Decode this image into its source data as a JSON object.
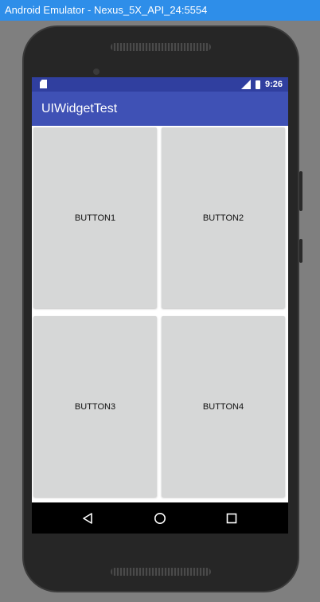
{
  "window": {
    "title": "Android Emulator - Nexus_5X_API_24:5554"
  },
  "status_bar": {
    "time": "9:26",
    "icons": [
      "sd-card-icon",
      "signal-icon",
      "battery-icon"
    ]
  },
  "app_bar": {
    "title": "UIWidgetTest"
  },
  "buttons": [
    {
      "label": "BUTTON1"
    },
    {
      "label": "BUTTON2"
    },
    {
      "label": "BUTTON3"
    },
    {
      "label": "BUTTON4"
    }
  ],
  "nav_bar": {
    "icons": [
      "back-icon",
      "home-icon",
      "recents-icon"
    ]
  },
  "colors": {
    "window_title": "#2e8ee9",
    "status_bar": "#303f9f",
    "app_bar": "#3f51b5",
    "button": "#d6d7d7"
  }
}
